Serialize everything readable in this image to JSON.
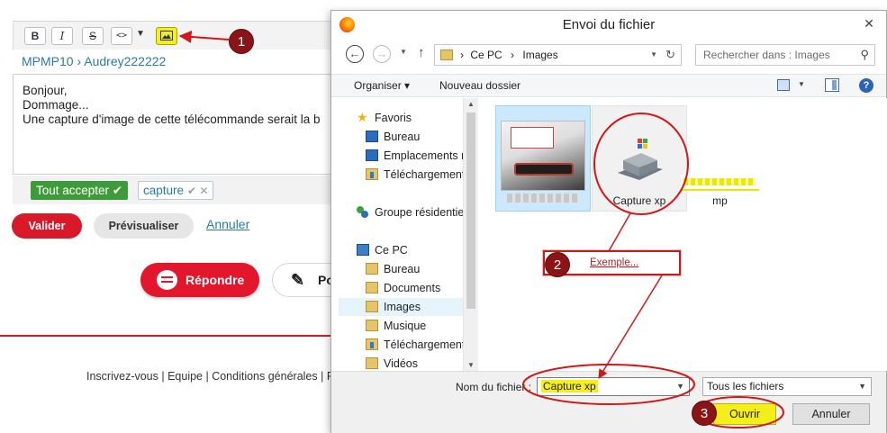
{
  "editor": {
    "toolbar": {
      "bold": "B",
      "italic": "I",
      "strike": "S",
      "code": "<>",
      "more": "▼"
    },
    "breadcrumb": "MPMP10 › Audrey222222",
    "message_lines": [
      "Bonjour,",
      "Dommage...",
      "Une capture d'image de cette télécommande serait la b"
    ],
    "accept_all": "Tout accepter ✔",
    "tag": "capture",
    "valider": "Valider",
    "preview": "Prévisualiser",
    "annuler": "Annuler",
    "reply": "Répondre",
    "post_partial": "Po",
    "footer": "Inscrivez-vous  |  Equipe  |  Conditions générales  |  F"
  },
  "annotations": {
    "badge1": "1",
    "badge2": "2",
    "badge3": "3",
    "exemple": "Exemple..."
  },
  "dialog": {
    "title": "Envoi du fichier",
    "close": "✕",
    "address": {
      "root": "Ce PC",
      "separator": "›",
      "current": "Images"
    },
    "search_placeholder": "Rechercher dans : Images",
    "organize": "Organiser ▾",
    "new_folder": "Nouveau dossier",
    "help": "?",
    "nav_items": [
      {
        "label": "Favoris"
      },
      {
        "label": "Bureau"
      },
      {
        "label": "Emplacements ré"
      },
      {
        "label": "Téléchargements"
      },
      {
        "label": "Groupe résidentiel"
      },
      {
        "label": "Ce PC"
      },
      {
        "label": "Bureau"
      },
      {
        "label": "Documents"
      },
      {
        "label": "Images"
      },
      {
        "label": "Musique"
      },
      {
        "label": "Téléchargements"
      },
      {
        "label": "Vidéos"
      }
    ],
    "files": [
      {
        "name": ""
      },
      {
        "name": "Capture xp"
      },
      {
        "name": "mp"
      }
    ],
    "filename_label": "Nom du fichier :",
    "filename_value": "Capture xp",
    "filetype": "Tous les fichiers",
    "open": "Ouvrir",
    "cancel": "Annuler"
  },
  "colors": {
    "accent_red": "#d9182a",
    "highlight_yellow": "#f4ef1a",
    "annot_red": "#c01d1d",
    "link_blue": "#2a7aa6",
    "accept_green": "#3e9b3a"
  }
}
